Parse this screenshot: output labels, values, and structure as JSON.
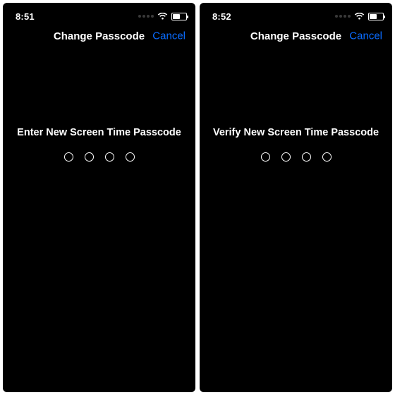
{
  "screens": [
    {
      "status": {
        "time": "8:51"
      },
      "nav": {
        "title": "Change Passcode",
        "cancel": "Cancel"
      },
      "prompt": "Enter New Screen Time Passcode",
      "passcode_length": 4
    },
    {
      "status": {
        "time": "8:52"
      },
      "nav": {
        "title": "Change Passcode",
        "cancel": "Cancel"
      },
      "prompt": "Verify New Screen Time Passcode",
      "passcode_length": 4
    }
  ],
  "colors": {
    "accent": "#0a6cff"
  }
}
